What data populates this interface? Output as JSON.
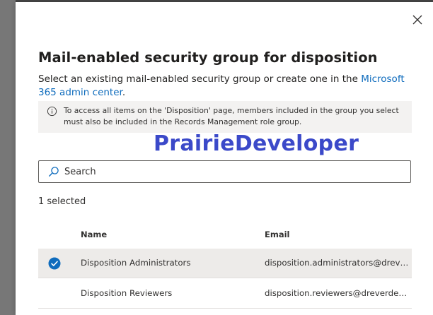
{
  "panel": {
    "title": "Mail-enabled security group for disposition",
    "description_prefix": "Select an existing mail-enabled security group or create one in the ",
    "description_link": "Microsoft 365 admin center",
    "description_suffix": "."
  },
  "info": {
    "icon": "info-icon",
    "text": "To access all items on the 'Disposition' page, members included in the group you select must also be included in the Records Management role group."
  },
  "watermark": "PrairieDeveloper",
  "search": {
    "placeholder": "Search",
    "value": "",
    "icon": "search-icon"
  },
  "selection": {
    "count_label": "1 selected"
  },
  "table": {
    "columns": [
      "Name",
      "Email"
    ],
    "rows": [
      {
        "name": "Disposition Administrators",
        "email": "disposition.administrators@dreverd...",
        "selected": true
      },
      {
        "name": "Disposition Reviewers",
        "email": "disposition.reviewers@dreverdev.on...",
        "selected": false
      }
    ]
  },
  "colors": {
    "accent": "#0f6cbd",
    "selected_row": "#edebe9",
    "info_background": "#f3f2f1",
    "watermark": "#3b49c9"
  }
}
